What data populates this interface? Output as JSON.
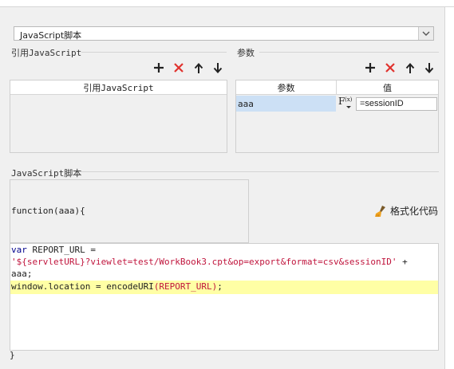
{
  "script_type_select": {
    "value": "JavaScript脚本"
  },
  "left_panel": {
    "title": "引用JavaScript",
    "column_header": "引用JavaScript"
  },
  "right_panel": {
    "title": "参数",
    "columns": [
      "参数",
      "值"
    ],
    "rows": [
      {
        "name": "aaa",
        "value": "=sessionID"
      }
    ]
  },
  "toolbar_icons": [
    "add-icon",
    "delete-icon",
    "move-up-icon",
    "move-down-icon"
  ],
  "colors": {
    "delete": "#e0322e",
    "add": "#222222",
    "selection": "#cce0f5",
    "line_highlight": "#ffffa5",
    "keyword": "#00008b",
    "string": "#c0143c"
  },
  "script_section": {
    "title": "JavaScript脚本",
    "function_signature": "function(aaa){",
    "format_button_label": "格式化代码",
    "code": {
      "line1_keyword": "var",
      "line1_rest": " REPORT_URL =",
      "line2_string": "'${servletURL}?viewlet=test/WorkBook3.cpt&op=export&format=csv&sessionID'",
      "line2_rest": " +",
      "line3": "aaa;",
      "line4_prefix": "window.location = encodeURI",
      "line4_paren_arg": "(REPORT_URL)",
      "line4_suffix": ";"
    },
    "closing": "}"
  }
}
